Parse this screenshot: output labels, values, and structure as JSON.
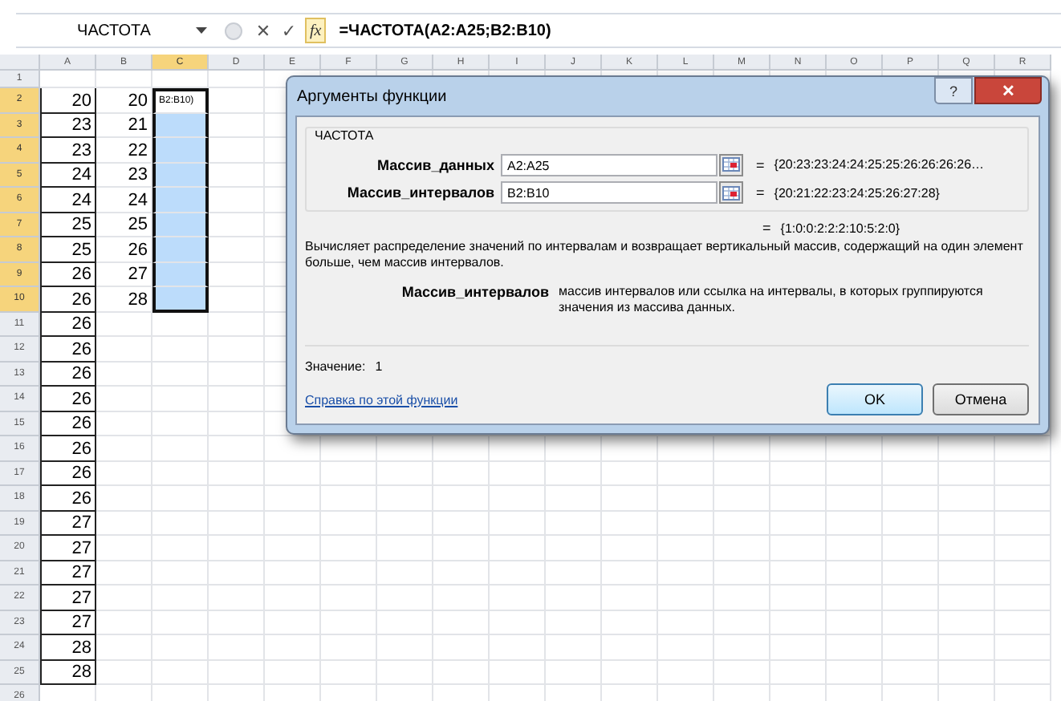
{
  "formula_bar": {
    "name_box": "ЧАСТОТА",
    "cancel": "✕",
    "enter": "✓",
    "function_button": "fx",
    "formula": "=ЧАСТОТА(A2:A25;B2:B10)"
  },
  "sheet": {
    "columns": [
      {
        "label": "A",
        "selected": false,
        "boxed": true
      },
      {
        "label": "B",
        "selected": false,
        "boxed": false
      },
      {
        "label": "C",
        "selected": true,
        "boxed": false
      },
      {
        "label": "D",
        "selected": false,
        "boxed": false
      },
      {
        "label": "E",
        "selected": false,
        "boxed": false
      },
      {
        "label": "F",
        "selected": false,
        "boxed": false
      },
      {
        "label": "G",
        "selected": false,
        "boxed": false
      },
      {
        "label": "H",
        "selected": false,
        "boxed": false
      },
      {
        "label": "I",
        "selected": false,
        "boxed": false
      },
      {
        "label": "J",
        "selected": false,
        "boxed": false
      },
      {
        "label": "K",
        "selected": false,
        "boxed": false
      },
      {
        "label": "L",
        "selected": false,
        "boxed": false
      },
      {
        "label": "M",
        "selected": false,
        "boxed": false
      },
      {
        "label": "N",
        "selected": false,
        "boxed": false
      },
      {
        "label": "O",
        "selected": false,
        "boxed": false
      },
      {
        "label": "P",
        "selected": false,
        "boxed": false
      },
      {
        "label": "Q",
        "selected": false,
        "boxed": false
      },
      {
        "label": "R",
        "selected": false,
        "boxed": false
      }
    ],
    "rows": [
      {
        "label": "1",
        "selected": false,
        "cells": {}
      },
      {
        "label": "2",
        "selected": true,
        "cells": {
          "A": "20",
          "B": "20",
          "C": "B2:B10)"
        }
      },
      {
        "label": "3",
        "selected": true,
        "cells": {
          "A": "23",
          "B": "21"
        }
      },
      {
        "label": "4",
        "selected": true,
        "cells": {
          "A": "23",
          "B": "22"
        }
      },
      {
        "label": "5",
        "selected": true,
        "cells": {
          "A": "24",
          "B": "23"
        }
      },
      {
        "label": "6",
        "selected": true,
        "cells": {
          "A": "24",
          "B": "24"
        }
      },
      {
        "label": "7",
        "selected": true,
        "cells": {
          "A": "25",
          "B": "25"
        }
      },
      {
        "label": "8",
        "selected": true,
        "cells": {
          "A": "25",
          "B": "26"
        }
      },
      {
        "label": "9",
        "selected": true,
        "cells": {
          "A": "26",
          "B": "27"
        }
      },
      {
        "label": "10",
        "selected": true,
        "cells": {
          "A": "26",
          "B": "28"
        }
      },
      {
        "label": "11",
        "selected": false,
        "cells": {
          "A": "26"
        }
      },
      {
        "label": "12",
        "selected": false,
        "cells": {
          "A": "26"
        }
      },
      {
        "label": "13",
        "selected": false,
        "cells": {
          "A": "26"
        }
      },
      {
        "label": "14",
        "selected": false,
        "cells": {
          "A": "26"
        }
      },
      {
        "label": "15",
        "selected": false,
        "cells": {
          "A": "26"
        }
      },
      {
        "label": "16",
        "selected": false,
        "cells": {
          "A": "26"
        }
      },
      {
        "label": "17",
        "selected": false,
        "cells": {
          "A": "26"
        }
      },
      {
        "label": "18",
        "selected": false,
        "cells": {
          "A": "26"
        }
      },
      {
        "label": "19",
        "selected": false,
        "cells": {
          "A": "27"
        }
      },
      {
        "label": "20",
        "selected": false,
        "cells": {
          "A": "27"
        }
      },
      {
        "label": "21",
        "selected": false,
        "cells": {
          "A": "27"
        }
      },
      {
        "label": "22",
        "selected": false,
        "cells": {
          "A": "27"
        }
      },
      {
        "label": "23",
        "selected": false,
        "cells": {
          "A": "27"
        }
      },
      {
        "label": "24",
        "selected": false,
        "cells": {
          "A": "28"
        }
      },
      {
        "label": "25",
        "selected": false,
        "cells": {
          "A": "28"
        }
      },
      {
        "label": "26",
        "selected": false,
        "cells": {}
      }
    ]
  },
  "dialog": {
    "title": "Аргументы функции",
    "help_button": "?",
    "close_button": "✕",
    "function_name": "ЧАСТОТА",
    "arguments": [
      {
        "label": "Массив_данных",
        "value": "A2:A25",
        "sign": "=",
        "result": "{20:23:23:24:24:25:25:26:26:26:26…"
      },
      {
        "label": "Массив_интервалов",
        "value": "B2:B10",
        "sign": "=",
        "result": "{20:21:22:23:24:25:26:27:28}"
      }
    ],
    "total_sign": "=",
    "total_result": "{1:0:0:2:2:2:10:5:2:0}",
    "description": "Вычисляет распределение значений по интервалам и возвращает вертикальный массив, содержащий на один элемент больше, чем массив интервалов.",
    "argument_help": {
      "label": "Массив_интервалов",
      "text": "массив интервалов или ссылка на интервалы, в которых группируются значения из массива данных."
    },
    "value_label": "Значение:",
    "value": "1",
    "help_link": "Справка по этой функции",
    "buttons": [
      {
        "label": "OK",
        "selected": true
      },
      {
        "label": "Отмена",
        "selected": false
      }
    ]
  }
}
